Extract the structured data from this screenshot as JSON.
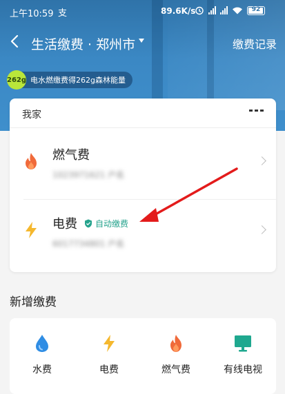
{
  "status_bar": {
    "time": "上午10:59",
    "app_icon": "支",
    "network_speed": "89.6K/s",
    "battery": "92",
    "icons": [
      "alarm-icon",
      "signal-icon",
      "signal-icon",
      "wifi-icon",
      "battery-icon"
    ]
  },
  "nav": {
    "title": "生活缴费 · 郑州市",
    "right_action": "缴费记录"
  },
  "promo": {
    "badge": "262g",
    "text": "电水燃缴费得262g森林能量"
  },
  "account_card": {
    "group_name": "我家",
    "items": [
      {
        "title": "燃气费",
        "subtitle": "1023971621 户名",
        "icon": "flame-icon"
      },
      {
        "title": "电费",
        "subtitle": "6017734801 户名",
        "icon": "lightning-icon",
        "badge": "自动缴费"
      }
    ]
  },
  "add_section": {
    "title": "新增缴费",
    "items": [
      {
        "label": "水费",
        "icon": "water-drop-icon"
      },
      {
        "label": "电费",
        "icon": "lightning-icon"
      },
      {
        "label": "燃气费",
        "icon": "flame-icon"
      },
      {
        "label": "有线电视",
        "icon": "tv-icon"
      }
    ]
  },
  "colors": {
    "header_blue": "#3b88c4",
    "flame": "#f06a3a",
    "lightning": "#f5b82e",
    "water": "#2f8de4",
    "tv": "#1fa88f",
    "auto_pay": "#26a38d",
    "annotation_arrow": "#e31b1b"
  }
}
